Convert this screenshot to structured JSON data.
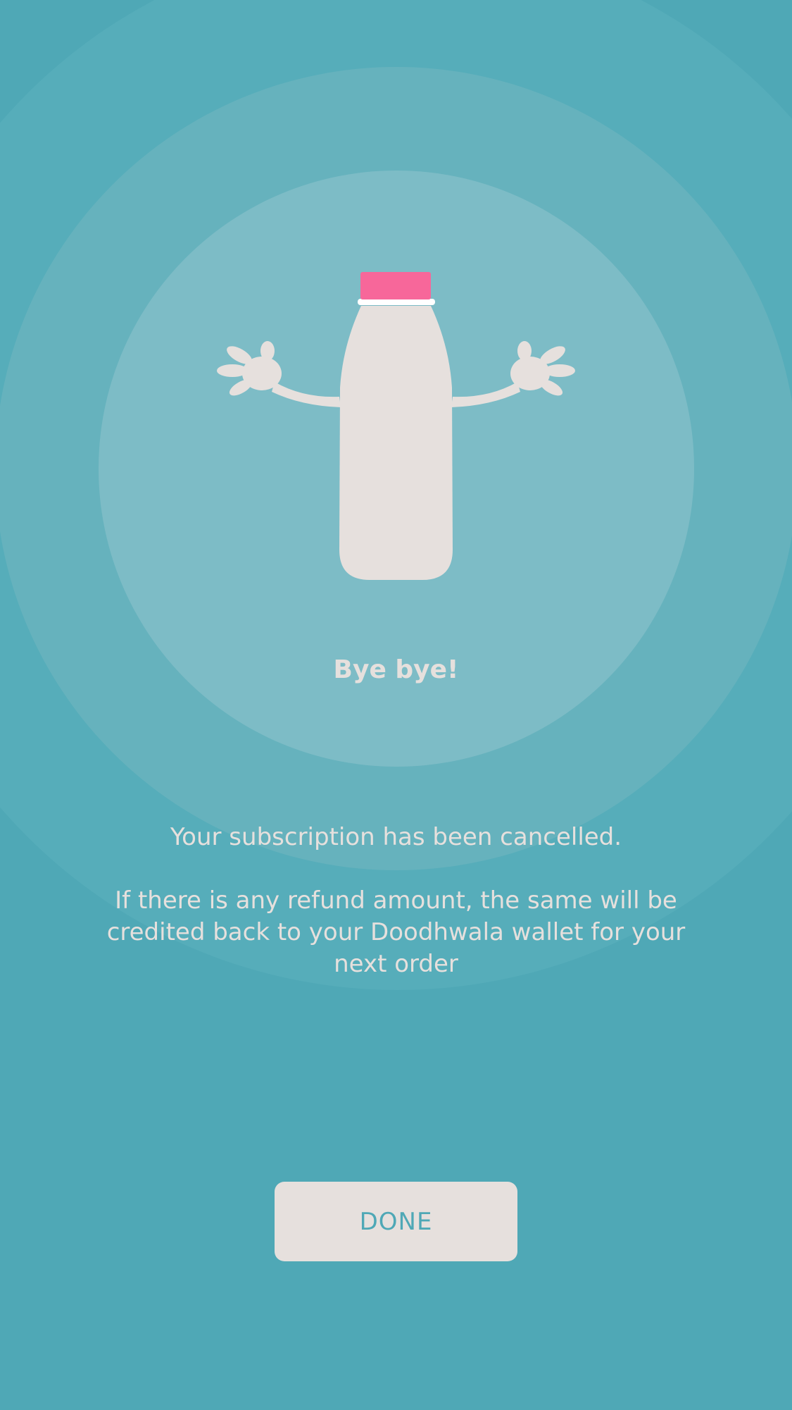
{
  "screen": {
    "title": "Bye bye!",
    "message_primary": "Your subscription has been cancelled.",
    "message_secondary": "If there is any refund amount, the same will be credited back to your Doodhwala wallet for your next order",
    "done_label": "DONE"
  },
  "illustration": {
    "icon": "milk-bottle-mascot-icon",
    "cap_color": "#f7679a",
    "bottle_color": "#e6e0dd"
  },
  "colors": {
    "background": "#4fa8b6",
    "accent": "#4fa8b6",
    "text": "#e6e0dd",
    "button_bg": "#e6e0dd"
  }
}
